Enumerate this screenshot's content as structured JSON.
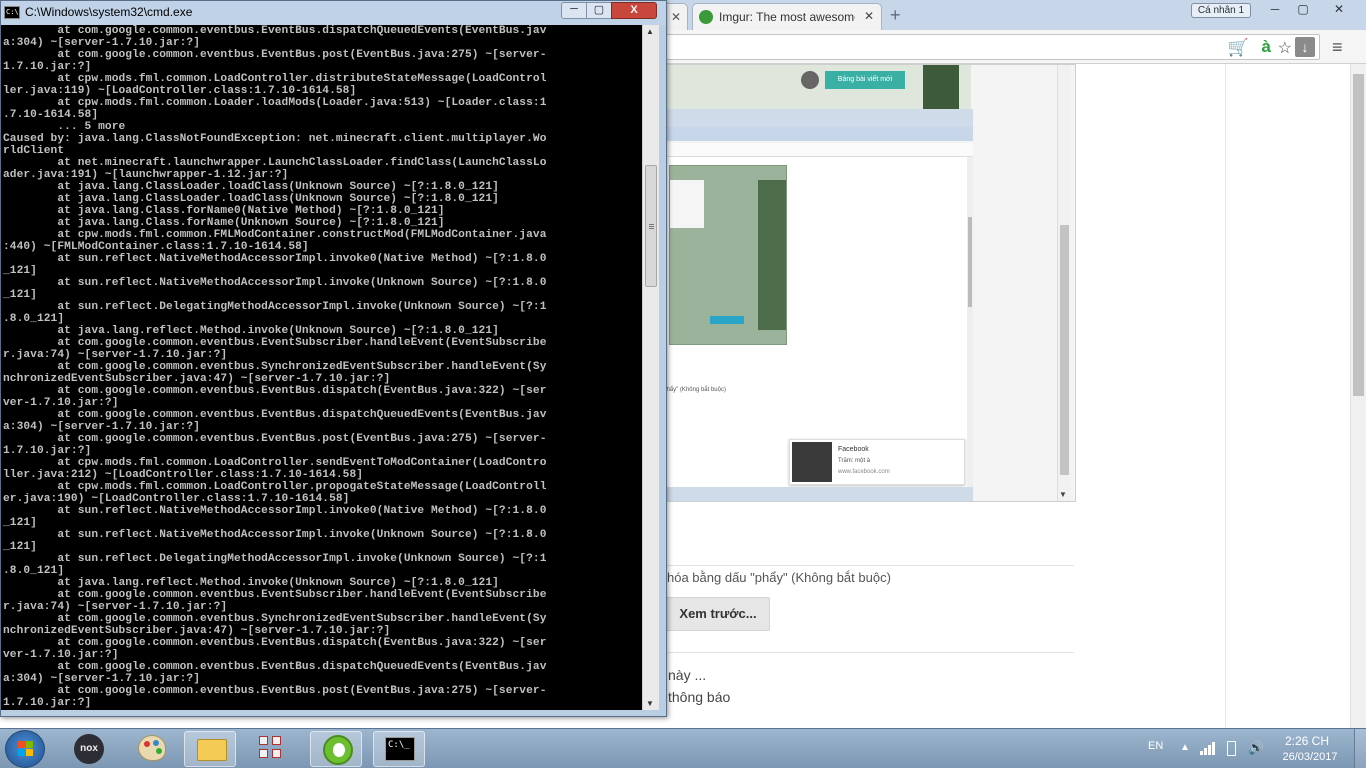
{
  "cmd": {
    "title": "C:\\Windows\\system32\\cmd.exe",
    "icon_text": "C:\\",
    "min_label": "─",
    "max_label": "▢",
    "close_label": "X",
    "lines": [
      "        at com.google.common.eventbus.EventBus.dispatchQueuedEvents(EventBus.jav",
      "a:304) ~[server-1.7.10.jar:?]",
      "        at com.google.common.eventbus.EventBus.post(EventBus.java:275) ~[server-",
      "1.7.10.jar:?]",
      "        at cpw.mods.fml.common.LoadController.distributeStateMessage(LoadControl",
      "ler.java:119) ~[LoadController.class:1.7.10-1614.58]",
      "        at cpw.mods.fml.common.Loader.loadMods(Loader.java:513) ~[Loader.class:1",
      ".7.10-1614.58]",
      "        ... 5 more",
      "Caused by: java.lang.ClassNotFoundException: net.minecraft.client.multiplayer.Wo",
      "rldClient",
      "        at net.minecraft.launchwrapper.LaunchClassLoader.findClass(LaunchClassLo",
      "ader.java:191) ~[launchwrapper-1.12.jar:?]",
      "        at java.lang.ClassLoader.loadClass(Unknown Source) ~[?:1.8.0_121]",
      "        at java.lang.ClassLoader.loadClass(Unknown Source) ~[?:1.8.0_121]",
      "        at java.lang.Class.forName0(Native Method) ~[?:1.8.0_121]",
      "        at java.lang.Class.forName(Unknown Source) ~[?:1.8.0_121]",
      "        at cpw.mods.fml.common.FMLModContainer.constructMod(FMLModContainer.java",
      ":440) ~[FMLModContainer.class:1.7.10-1614.58]",
      "        at sun.reflect.NativeMethodAccessorImpl.invoke0(Native Method) ~[?:1.8.0",
      "_121]",
      "        at sun.reflect.NativeMethodAccessorImpl.invoke(Unknown Source) ~[?:1.8.0",
      "_121]",
      "        at sun.reflect.DelegatingMethodAccessorImpl.invoke(Unknown Source) ~[?:1",
      ".8.0_121]",
      "        at java.lang.reflect.Method.invoke(Unknown Source) ~[?:1.8.0_121]",
      "        at com.google.common.eventbus.EventSubscriber.handleEvent(EventSubscribe",
      "r.java:74) ~[server-1.7.10.jar:?]",
      "        at com.google.common.eventbus.SynchronizedEventSubscriber.handleEvent(Sy",
      "nchronizedEventSubscriber.java:47) ~[server-1.7.10.jar:?]",
      "        at com.google.common.eventbus.EventBus.dispatch(EventBus.java:322) ~[ser",
      "ver-1.7.10.jar:?]",
      "        at com.google.common.eventbus.EventBus.dispatchQueuedEvents(EventBus.jav",
      "a:304) ~[server-1.7.10.jar:?]",
      "        at com.google.common.eventbus.EventBus.post(EventBus.java:275) ~[server-",
      "1.7.10.jar:?]",
      "        at cpw.mods.fml.common.LoadController.sendEventToModContainer(LoadContro",
      "ller.java:212) ~[LoadController.class:1.7.10-1614.58]",
      "        at cpw.mods.fml.common.LoadController.propogateStateMessage(LoadControll",
      "er.java:190) ~[LoadController.class:1.7.10-1614.58]",
      "        at sun.reflect.NativeMethodAccessorImpl.invoke0(Native Method) ~[?:1.8.0",
      "_121]",
      "        at sun.reflect.NativeMethodAccessorImpl.invoke(Unknown Source) ~[?:1.8.0",
      "_121]",
      "        at sun.reflect.DelegatingMethodAccessorImpl.invoke(Unknown Source) ~[?:1",
      ".8.0_121]",
      "        at java.lang.reflect.Method.invoke(Unknown Source) ~[?:1.8.0_121]",
      "        at com.google.common.eventbus.EventSubscriber.handleEvent(EventSubscribe",
      "r.java:74) ~[server-1.7.10.jar:?]",
      "        at com.google.common.eventbus.SynchronizedEventSubscriber.handleEvent(Sy",
      "nchronizedEventSubscriber.java:47) ~[server-1.7.10.jar:?]",
      "        at com.google.common.eventbus.EventBus.dispatch(EventBus.java:322) ~[ser",
      "ver-1.7.10.jar:?]",
      "        at com.google.common.eventbus.EventBus.dispatchQueuedEvents(EventBus.jav",
      "a:304) ~[server-1.7.10.jar:?]",
      "        at com.google.common.eventbus.EventBus.post(EventBus.java:275) ~[server-",
      "1.7.10.jar:?]"
    ]
  },
  "browser": {
    "tab_close": "✕",
    "active_tab_title": "Imgur: The most awesome",
    "new_tab_label": "+",
    "profile_label": "Cá nhân 1",
    "win_min": "─",
    "win_max": "▢",
    "win_close": "✕",
    "ext_icon_text": "à",
    "page": {
      "preview_button_label": "Bảng bài viết mới",
      "preview_tags_hint": "\"phẩy\" (Không bắt buộc)",
      "fb_title": "Facebook",
      "fb_subtitle": "Trăm: một ả",
      "fb_url": "www.facebook.com",
      "tags_hint": "hóa bằng dấu \"phẩy\" (Không bắt buộc)",
      "preview_label": "Xem trước...",
      "text_line_1": "này ...",
      "text_line_2": "thông báo"
    }
  },
  "taskbar": {
    "nox_label": "nox",
    "cmd_icon_text": "C:\\_",
    "tray": {
      "lang": "EN",
      "time": "2:26 CH",
      "date": "26/03/2017"
    }
  },
  "colors": {
    "cmd_background": "#000000",
    "cmd_text": "#c0c0c0",
    "taskbar": "#8aa4c0",
    "browser_tabstrip": "#c7d6e8"
  }
}
